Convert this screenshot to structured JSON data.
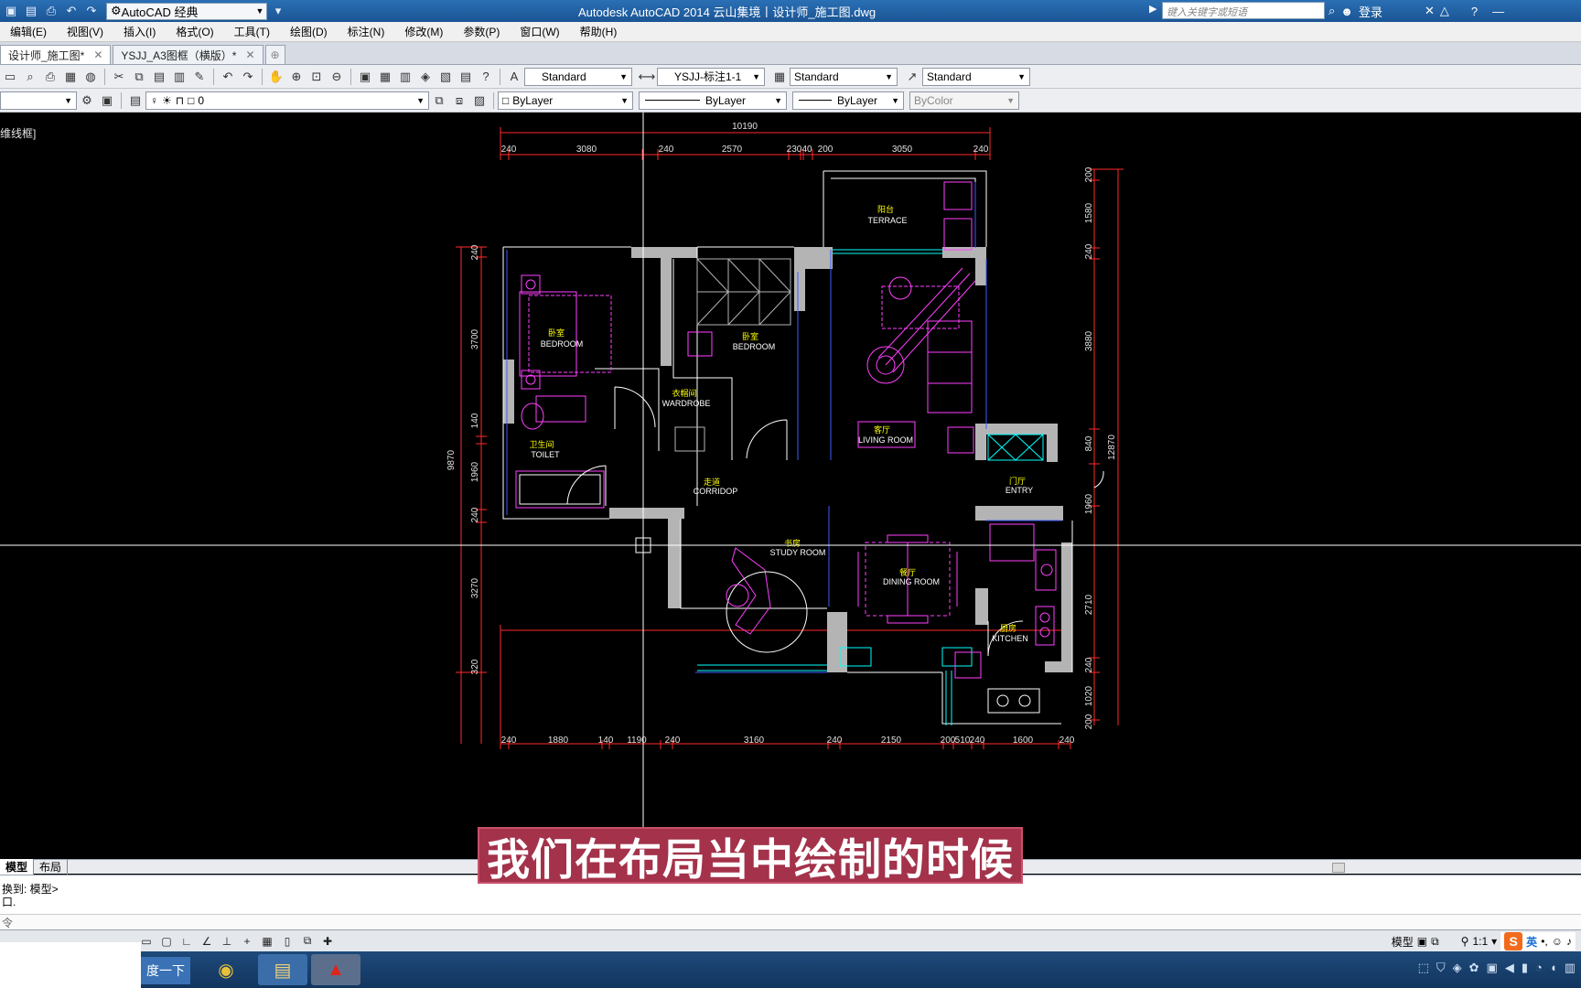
{
  "app": {
    "window_title": "Autodesk AutoCAD 2014    云山集境丨设计师_施工图.dwg",
    "workspace": "AutoCAD 经典",
    "search_placeholder": "键入关键字或短语",
    "login": "登录"
  },
  "menu": [
    "编辑(E)",
    "视图(V)",
    "插入(I)",
    "格式(O)",
    "工具(T)",
    "绘图(D)",
    "标注(N)",
    "修改(M)",
    "参数(P)",
    "窗口(W)",
    "帮助(H)"
  ],
  "doc_tabs": [
    {
      "label": "设计师_施工图*",
      "close": "✕"
    },
    {
      "label": "YSJJ_A3图框（横版）*",
      "close": "✕"
    }
  ],
  "styles_toolbar": {
    "text_style": "Standard",
    "dim_style": "YSJJ-标注1-1",
    "table_style": "Standard",
    "multileader_style": "Standard"
  },
  "layers_toolbar": {
    "layer_name": "0",
    "color": "ByLayer",
    "linetype": "ByLayer",
    "lineweight": "ByLayer",
    "plot_style": "ByColor"
  },
  "viewport_label": "维线框]",
  "plan": {
    "overall_top": "10190",
    "top_dims": [
      "240",
      "3080",
      "240",
      "2570",
      "230",
      "40",
      "200",
      "3050",
      "240"
    ],
    "bottom_dims": [
      "240",
      "1880",
      "140",
      "1190",
      "240",
      "3160",
      "240",
      "2150",
      "200",
      "510",
      "240",
      "1600",
      "240"
    ],
    "left_dims": [
      "240",
      "3700",
      "140",
      "1960",
      "240",
      "3270",
      "320"
    ],
    "left_total": "9870",
    "right_dims": [
      "200",
      "1580",
      "240",
      "3880",
      "840",
      "1960",
      "2710",
      "240",
      "1020",
      "200"
    ],
    "right_total": "12870",
    "rooms": [
      {
        "cn": "阳台",
        "en": "TERRACE"
      },
      {
        "cn": "卧室",
        "en": "BEDROOM"
      },
      {
        "cn": "卧室",
        "en": "BEDROOM"
      },
      {
        "cn": "衣帽间",
        "en": "WARDROBE"
      },
      {
        "cn": "卫生间",
        "en": "TOILET"
      },
      {
        "cn": "客厅",
        "en": "LIVING ROOM"
      },
      {
        "cn": "走道",
        "en": "CORRIDOP"
      },
      {
        "cn": "门厅",
        "en": "ENTRY"
      },
      {
        "cn": "书房",
        "en": "STUDY ROOM"
      },
      {
        "cn": "餐厅",
        "en": "DINING ROOM"
      },
      {
        "cn": "厨房",
        "en": "KITCHEN"
      }
    ]
  },
  "layout_tabs": [
    "模型",
    "布局"
  ],
  "command": {
    "line1": "换到: 模型>",
    "line2": "口.",
    "prompt": "令"
  },
  "status": {
    "model_label": "模型",
    "scale": "1:1",
    "ime_lang": "英"
  },
  "taskbar": {
    "search_label": "度一下"
  },
  "subtitle": "我们在布局当中绘制的时候",
  "colors": {
    "wall": "#b4b4b4",
    "dim": "#ff2a2a",
    "furniture": "#ff40ff",
    "text": "#ffff00",
    "door": "#ffffff",
    "window": "#00ffff",
    "titlebar": "#1f5c9e",
    "subtitle_bg": "#a3324a"
  },
  "icons": [
    "save-icon",
    "print-icon",
    "undo-icon",
    "redo-icon",
    "pan-icon",
    "zoom-icon",
    "layer-icon",
    "help-icon"
  ]
}
